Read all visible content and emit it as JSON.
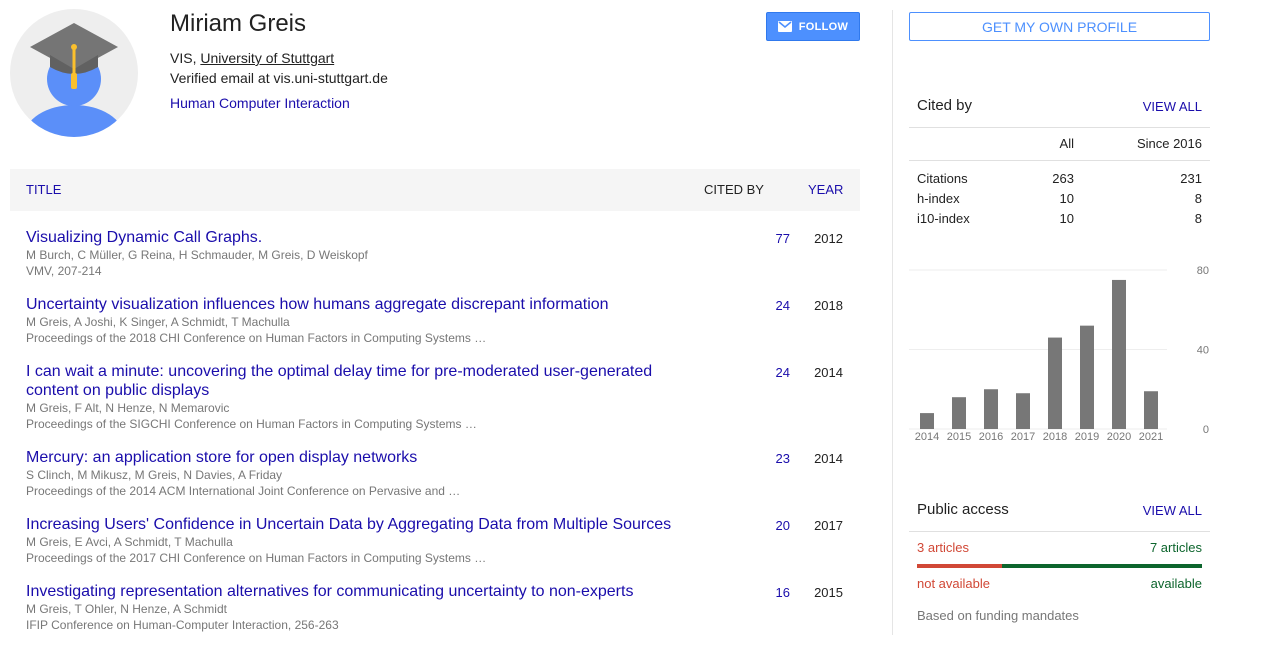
{
  "profile": {
    "name": "Miriam Greis",
    "affiliation_prefix": "VIS, ",
    "affiliation_link": "University of Stuttgart",
    "email": "Verified email at vis.uni-stuttgart.de",
    "interest": "Human Computer Interaction",
    "follow_label": "FOLLOW"
  },
  "table": {
    "col_title": "TITLE",
    "col_cited": "CITED BY",
    "col_year": "YEAR",
    "rows": [
      {
        "title": "Visualizing Dynamic Call Graphs.",
        "authors": "M Burch, C Müller, G Reina, H Schmauder, M Greis, D Weiskopf",
        "venue": "VMV, 207-214",
        "cites": "77",
        "year": "2012"
      },
      {
        "title": "Uncertainty visualization influences how humans aggregate discrepant information",
        "authors": "M Greis, A Joshi, K Singer, A Schmidt, T Machulla",
        "venue": "Proceedings of the 2018 CHI Conference on Human Factors in Computing Systems …",
        "cites": "24",
        "year": "2018"
      },
      {
        "title": "I can wait a minute: uncovering the optimal delay time for pre-moderated user-generated content on public displays",
        "authors": "M Greis, F Alt, N Henze, N Memarovic",
        "venue": "Proceedings of the SIGCHI Conference on Human Factors in Computing Systems …",
        "cites": "24",
        "year": "2014"
      },
      {
        "title": "Mercury: an application store for open display networks",
        "authors": "S Clinch, M Mikusz, M Greis, N Davies, A Friday",
        "venue": "Proceedings of the 2014 ACM International Joint Conference on Pervasive and …",
        "cites": "23",
        "year": "2014"
      },
      {
        "title": "Increasing Users' Confidence in Uncertain Data by Aggregating Data from Multiple Sources",
        "authors": "M Greis, E Avci, A Schmidt, T Machulla",
        "venue": "Proceedings of the 2017 CHI Conference on Human Factors in Computing Systems …",
        "cites": "20",
        "year": "2017"
      },
      {
        "title": "Investigating representation alternatives for communicating uncertainty to non-experts",
        "authors": "M Greis, T Ohler, N Henze, A Schmidt",
        "venue": "IFIP Conference on Human-Computer Interaction, 256-263",
        "cites": "16",
        "year": "2015"
      }
    ]
  },
  "sidebar": {
    "own_profile_label": "GET MY OWN PROFILE",
    "cited_by": {
      "title": "Cited by",
      "view_all": "VIEW ALL",
      "col_all": "All",
      "col_since": "Since 2016",
      "rows": [
        {
          "label": "Citations",
          "all": "263",
          "since": "231"
        },
        {
          "label": "h-index",
          "all": "10",
          "since": "8"
        },
        {
          "label": "i10-index",
          "all": "10",
          "since": "8"
        }
      ]
    },
    "public_access": {
      "title": "Public access",
      "view_all": "VIEW ALL",
      "not_available_count": "3 articles",
      "available_count": "7 articles",
      "not_available_label": "not available",
      "available_label": "available",
      "note": "Based on funding mandates",
      "not_available_color": "#d14836",
      "available_color": "#0d652d"
    }
  },
  "chart_data": {
    "type": "bar",
    "categories": [
      "2014",
      "2015",
      "2016",
      "2017",
      "2018",
      "2019",
      "2020",
      "2021"
    ],
    "values": [
      8,
      16,
      20,
      18,
      46,
      52,
      75,
      19
    ],
    "yticks": [
      "0",
      "40",
      "80"
    ],
    "ylim": [
      0,
      80
    ],
    "color": "#777777"
  }
}
